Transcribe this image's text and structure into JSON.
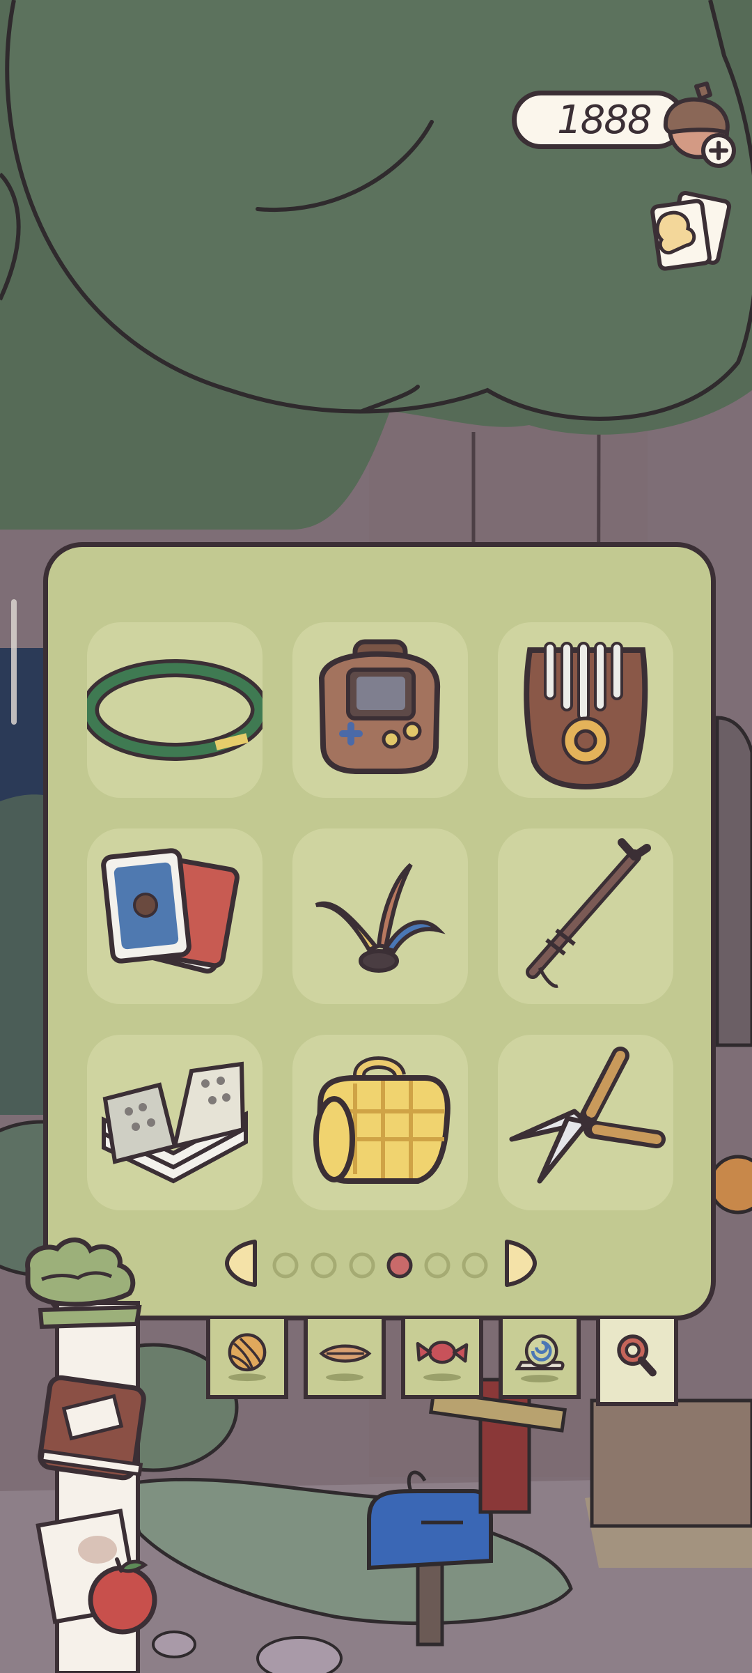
{
  "header": {
    "currency_amount": "1888",
    "currency_icon": "acorn-icon",
    "add_icon": "plus-icon",
    "cards_icon": "cards-icon"
  },
  "inventory": {
    "items": [
      {
        "name": "hula-hoop",
        "icon": "ring-icon"
      },
      {
        "name": "handheld-game",
        "icon": "game-console-icon"
      },
      {
        "name": "kalimba",
        "icon": "kalimba-icon"
      },
      {
        "name": "playing-cards",
        "icon": "cards-icon"
      },
      {
        "name": "feather-toy",
        "icon": "feather-icon"
      },
      {
        "name": "slingshot",
        "icon": "slingshot-icon"
      },
      {
        "name": "notebook",
        "icon": "book-icon"
      },
      {
        "name": "picnic-blanket",
        "icon": "blanket-icon"
      },
      {
        "name": "hedge-shears",
        "icon": "shears-icon"
      }
    ],
    "pagination": {
      "total_pages": 6,
      "current_page": 4
    }
  },
  "tabs": [
    {
      "name": "tab-yarn",
      "icon": "yarn-icon"
    },
    {
      "name": "tab-leaf",
      "icon": "leaf-icon"
    },
    {
      "name": "tab-candy",
      "icon": "candy-icon"
    },
    {
      "name": "tab-snail",
      "icon": "snail-icon"
    },
    {
      "name": "tab-magnifier",
      "icon": "magnifier-icon"
    }
  ],
  "colors": {
    "panel": "#c2c991",
    "slot": "#cfd4a0",
    "outline": "#3b2f35",
    "active_dot": "#c96a6a",
    "canopy": "#5a6e5b"
  }
}
